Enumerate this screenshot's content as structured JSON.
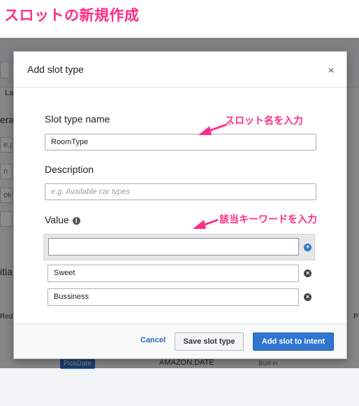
{
  "page_heading": "スロットの新規作成",
  "background": {
    "tab_fragment": "La",
    "side_fragment_1": "era",
    "input_fragment_1": "e.g. like",
    "input_fragment_2": "n",
    "input_fragment_3": "ok ro",
    "side_fragment_2": "itia",
    "side_fragment_3": "Red",
    "right_fragment": "P",
    "badge": "PickDate",
    "slot_type_value": "AMAZON.DATE",
    "builtin_label": "Built-in"
  },
  "modal": {
    "title": "Add slot type",
    "close_label": "×",
    "slot_type_name_label": "Slot type name",
    "slot_type_name_value": "RoomType",
    "description_label": "Description",
    "description_placeholder": "e.g. Available car types",
    "value_label": "Value",
    "value_input_text": "",
    "values": [
      "Sweet",
      "Bussiness"
    ],
    "footer": {
      "cancel": "Cancel",
      "save": "Save slot type",
      "add_to_intent": "Add slot to intent"
    }
  },
  "annotations": {
    "slot_name_hint": "スロット名を入力",
    "keyword_hint": "該当キーワードを入力"
  },
  "colors": {
    "annotation_pink": "#ff2d87",
    "primary_button": "#2f76cf",
    "overlay": "rgba(0,0,0,0.45)"
  }
}
